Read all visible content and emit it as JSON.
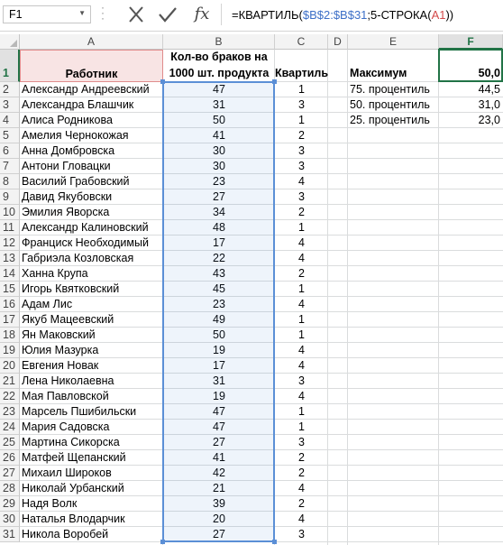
{
  "formula_bar": {
    "name_box": "F1",
    "formula_parts": [
      {
        "text": "=КВАРТИЛЬ(",
        "cls": ""
      },
      {
        "text": "$B$2:$B$31",
        "cls": "ref-blue"
      },
      {
        "text": ";5-СТРОКА(",
        "cls": ""
      },
      {
        "text": "A1",
        "cls": "ref-red"
      },
      {
        "text": "))",
        "cls": ""
      }
    ]
  },
  "columns": [
    "A",
    "B",
    "C",
    "D",
    "E",
    "F"
  ],
  "selected_column": "F",
  "selected_row": "1",
  "header_row": {
    "a": "Работник",
    "b_line1": "Кол-во браков на",
    "b_line2": "1000 шт. продукта",
    "c": "Квартиль",
    "e": "Максимум",
    "f": "50,0"
  },
  "side_stats": [
    {
      "label": "75. процентиль",
      "value": "44,5"
    },
    {
      "label": "50. процентиль",
      "value": "31,0"
    },
    {
      "label": "25. процентиль",
      "value": "23,0"
    }
  ],
  "rows": [
    {
      "num": "2",
      "name": "Александр Андреевский",
      "defects": "47",
      "quartile": "1"
    },
    {
      "num": "3",
      "name": "Александра Блашчик",
      "defects": "31",
      "quartile": "3"
    },
    {
      "num": "4",
      "name": "Алиса Родникова",
      "defects": "50",
      "quartile": "1"
    },
    {
      "num": "5",
      "name": "Амелия Чернокожая",
      "defects": "41",
      "quartile": "2"
    },
    {
      "num": "6",
      "name": "Анна Домбровска",
      "defects": "30",
      "quartile": "3"
    },
    {
      "num": "7",
      "name": "Антони Гловацки",
      "defects": "30",
      "quartile": "3"
    },
    {
      "num": "8",
      "name": "Василий Грабовский",
      "defects": "23",
      "quartile": "4"
    },
    {
      "num": "9",
      "name": "Давид Якубовски",
      "defects": "27",
      "quartile": "3"
    },
    {
      "num": "10",
      "name": "Эмилия Яворска",
      "defects": "34",
      "quartile": "2"
    },
    {
      "num": "11",
      "name": "Александр Калиновский",
      "defects": "48",
      "quartile": "1"
    },
    {
      "num": "12",
      "name": "Франциск Необходимый",
      "defects": "17",
      "quartile": "4"
    },
    {
      "num": "13",
      "name": "Габриэла Козловская",
      "defects": "22",
      "quartile": "4"
    },
    {
      "num": "14",
      "name": "Ханна Крупа",
      "defects": "43",
      "quartile": "2"
    },
    {
      "num": "15",
      "name": "Игорь Квятковский",
      "defects": "45",
      "quartile": "1"
    },
    {
      "num": "16",
      "name": "Адам Лис",
      "defects": "23",
      "quartile": "4"
    },
    {
      "num": "17",
      "name": "Якуб Мацеевский",
      "defects": "49",
      "quartile": "1"
    },
    {
      "num": "18",
      "name": "Ян Маковский",
      "defects": "50",
      "quartile": "1"
    },
    {
      "num": "19",
      "name": "Юлия Мазурка",
      "defects": "19",
      "quartile": "4"
    },
    {
      "num": "20",
      "name": "Евгения Новак",
      "defects": "17",
      "quartile": "4"
    },
    {
      "num": "21",
      "name": "Лена Николаевна",
      "defects": "31",
      "quartile": "3"
    },
    {
      "num": "22",
      "name": "Мая Павловской",
      "defects": "19",
      "quartile": "4"
    },
    {
      "num": "23",
      "name": "Марсель Пшибильски",
      "defects": "47",
      "quartile": "1"
    },
    {
      "num": "24",
      "name": "Мария Садовска",
      "defects": "47",
      "quartile": "1"
    },
    {
      "num": "25",
      "name": "Мартина Сикорска",
      "defects": "27",
      "quartile": "3"
    },
    {
      "num": "26",
      "name": "Матфей Щепанский",
      "defects": "41",
      "quartile": "2"
    },
    {
      "num": "27",
      "name": "Михаил Широков",
      "defects": "42",
      "quartile": "2"
    },
    {
      "num": "28",
      "name": "Николай Урбанский",
      "defects": "21",
      "quartile": "4"
    },
    {
      "num": "29",
      "name": "Надя Волк",
      "defects": "39",
      "quartile": "2"
    },
    {
      "num": "30",
      "name": "Наталья Влодарчик",
      "defects": "20",
      "quartile": "4"
    },
    {
      "num": "31",
      "name": "Никола Воробей",
      "defects": "27",
      "quartile": "3"
    }
  ],
  "colors": {
    "accent": "#217346",
    "range_blue": "#5b8fd6",
    "range_red": "#d86a6a"
  }
}
